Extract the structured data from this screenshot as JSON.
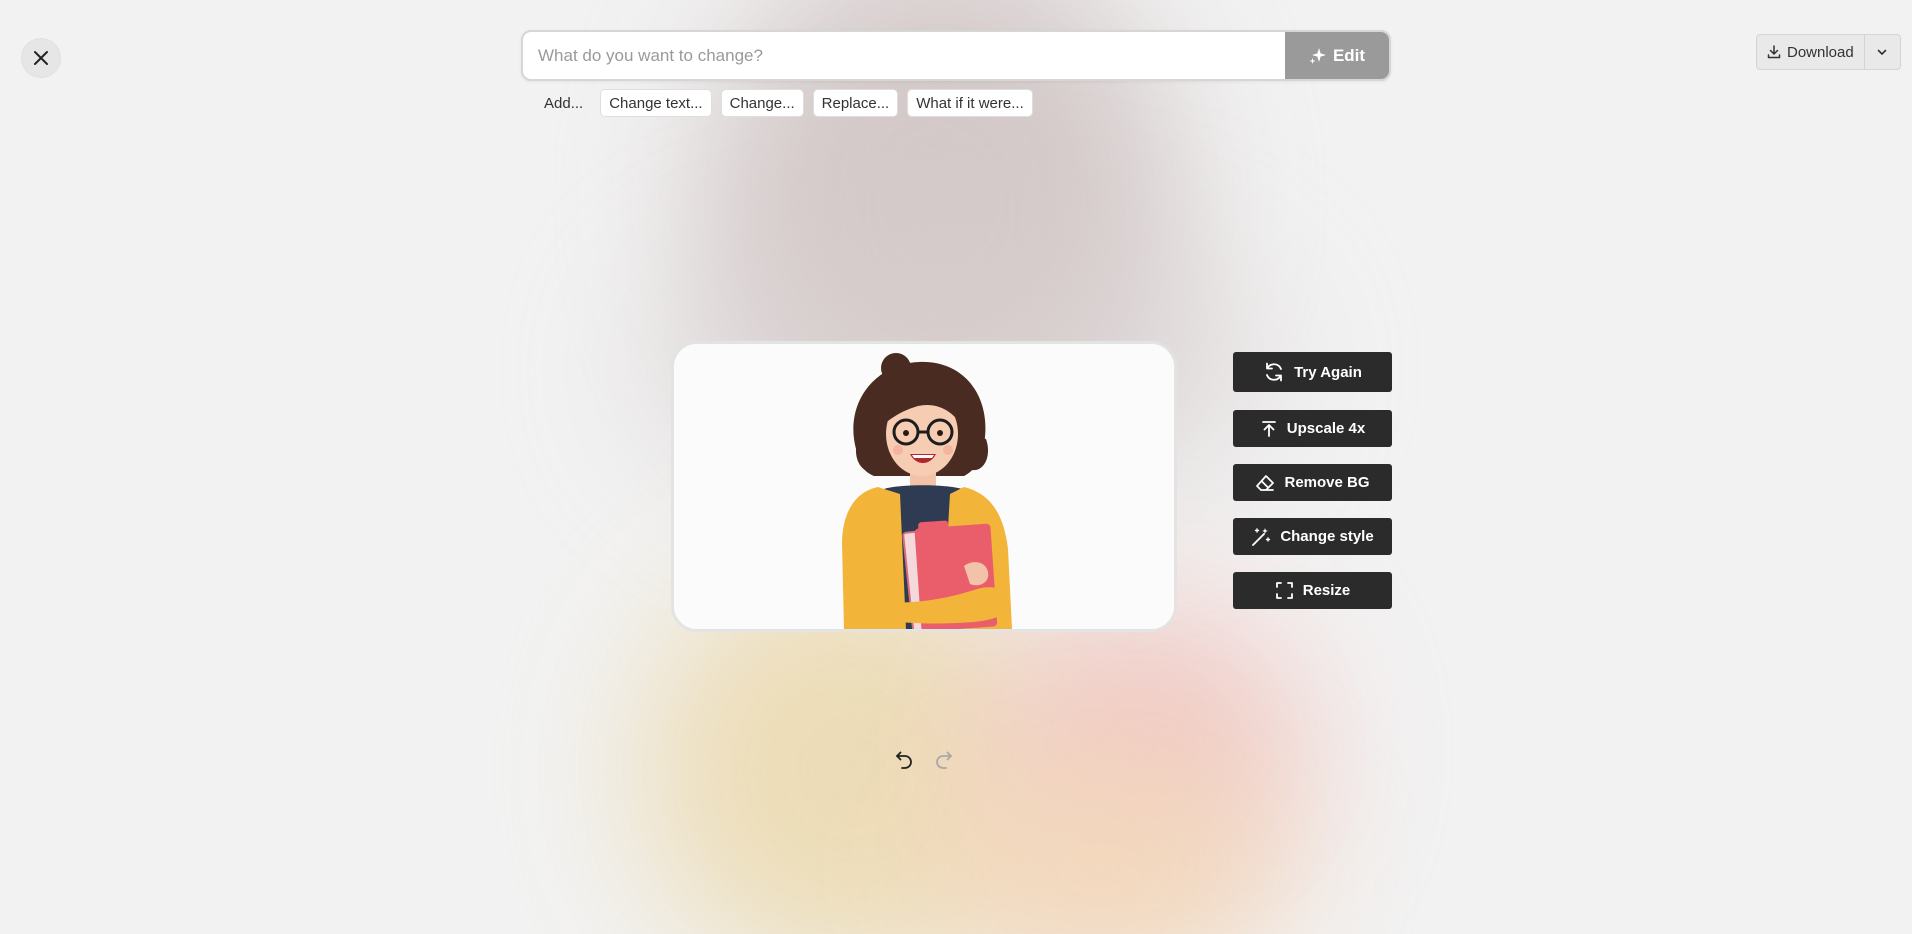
{
  "close": {
    "icon": "close-icon"
  },
  "prompt": {
    "placeholder": "What do you want to change?",
    "edit_label": "Edit",
    "edit_icon": "sparkle-icon"
  },
  "suggestions": [
    "Add...",
    "Change text...",
    "Change...",
    "Replace...",
    "What if it were..."
  ],
  "download": {
    "label": "Download",
    "icon": "download-icon",
    "menu_icon": "chevron-down-icon"
  },
  "image": {
    "subject": "illustration-woman-holding-folders"
  },
  "actions": [
    {
      "label": "Try Again",
      "icon": "refresh-icon"
    },
    {
      "label": "Upscale 4x",
      "icon": "upscale-icon"
    },
    {
      "label": "Remove BG",
      "icon": "eraser-icon"
    },
    {
      "label": "Change style",
      "icon": "magic-wand-icon"
    },
    {
      "label": "Resize",
      "icon": "resize-frame-icon"
    }
  ],
  "history": {
    "undo_icon": "undo-icon",
    "redo_icon": "redo-icon",
    "redo_enabled": false
  },
  "colors": {
    "action_bg": "#2b2b2b",
    "edit_bg": "#9a9a9a",
    "page_bg": "#f2f2f2"
  }
}
